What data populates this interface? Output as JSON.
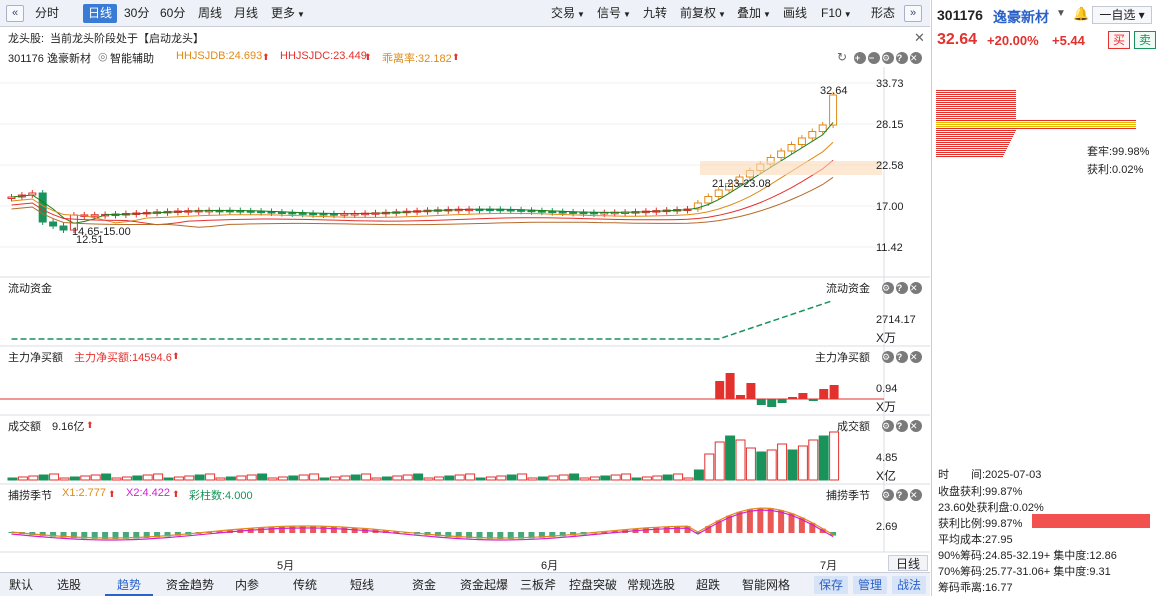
{
  "toolbar": {
    "left": [
      "分时",
      "日线",
      "30分",
      "60分",
      "周线",
      "月线",
      "更多"
    ],
    "active": "日线",
    "right": [
      "交易",
      "信号",
      "九转",
      "前复权",
      "叠加",
      "画线",
      "F10",
      "形态"
    ]
  },
  "signal": {
    "label": "龙头股:",
    "text": "当前龙头阶段处于【启动龙头】"
  },
  "legend": {
    "name": "301176 逸豪新材",
    "assist": "智能辅助",
    "db": "HHJSJDB:24.693",
    "dc": "HHJSJDC:23.449",
    "dev": "乖离率:32.182"
  },
  "price_axis": [
    "33.73",
    "28.15",
    "22.58",
    "17.00",
    "11.42"
  ],
  "annotations": {
    "high": "32.64",
    "range1": "21.23-23.08",
    "range2": "14.65-15.00",
    "low": "12.51"
  },
  "panels": {
    "flow": {
      "title": "流动资金",
      "value": "2714.17",
      "unit": "X万"
    },
    "net": {
      "title": "主力净买额",
      "value_label": "主力净买额:14594.6",
      "axis": "0.94",
      "unit": "X万"
    },
    "vol": {
      "title": "成交额",
      "value_label": "9.16亿",
      "axis": "4.85",
      "unit": "X亿"
    },
    "season": {
      "title": "捕捞季节",
      "x1": "X1:2.777",
      "x2": "X2:4.422",
      "bars": "彩柱数:4.000",
      "axis": "2.69"
    }
  },
  "months": [
    "5月",
    "6月",
    "7月"
  ],
  "daily_label": "日线",
  "bottom_tabs": [
    "默认",
    "选股",
    "趋势",
    "资金趋势",
    "内参",
    "传统",
    "短线",
    "资金",
    "资金起爆",
    "三板斧",
    "控盘突破",
    "常规选股",
    "超跌",
    "智能网格"
  ],
  "bottom_active": "趋势",
  "bottom_right": [
    "保存",
    "管理",
    "战法"
  ],
  "right_panel": {
    "code": "301176",
    "name": "逸豪新材",
    "watch": "一自选",
    "price": "32.64",
    "pct": "+20.00%",
    "chg": "+5.44",
    "buy": "买",
    "sell": "卖",
    "locked": "套牢:99.98%",
    "profit": "获利:0.02%",
    "date_label": "时　　间:2025-07-03",
    "close_profit": "收盘获利:99.87%",
    "at_price": "23.60处获利盘:0.02%",
    "ratio": "获利比例:99.87%",
    "avg_cost": "平均成本:27.95",
    "chip90": "90%筹码:24.85-32.19+ 集中度:12.86",
    "chip70": "70%筹码:25.77-31.06+ 集中度:9.31",
    "chip_dev": "筹码乖离:16.77"
  },
  "colors": {
    "up": "#e3312d",
    "down": "#19925b",
    "orange": "#e08a16",
    "accent": "#2b62c8"
  }
}
